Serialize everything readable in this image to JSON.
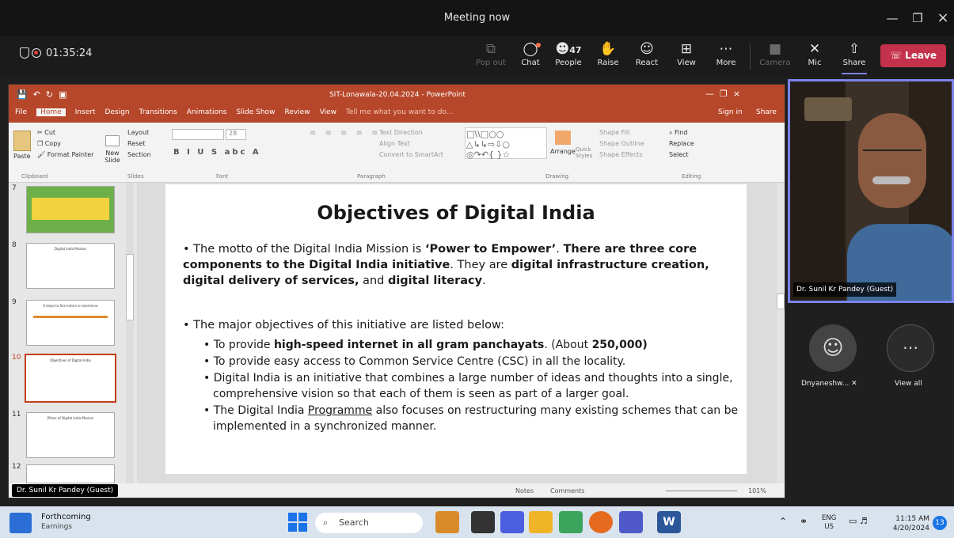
{
  "window": {
    "title": "Meeting now"
  },
  "toolbar": {
    "timer": "01:35:24",
    "buttons": [
      {
        "label": "Pop out",
        "icon": "popout-icon"
      },
      {
        "label": "Chat",
        "icon": "chat-icon"
      },
      {
        "label": "People",
        "icon": "people-icon",
        "count": "47"
      },
      {
        "label": "Raise",
        "icon": "hand-icon"
      },
      {
        "label": "React",
        "icon": "smile-icon"
      },
      {
        "label": "View",
        "icon": "grid-icon"
      },
      {
        "label": "More",
        "icon": "more-icon"
      },
      {
        "label": "Camera",
        "icon": "camera-off-icon"
      },
      {
        "label": "Mic",
        "icon": "mic-off-icon"
      },
      {
        "label": "Share",
        "icon": "share-icon"
      }
    ],
    "leave": "Leave"
  },
  "ppt": {
    "title": "SIT-Lonawala-20.04.2024 - PowerPoint",
    "tabs": [
      "File",
      "Home",
      "Insert",
      "Design",
      "Transitions",
      "Animations",
      "Slide Show",
      "Review",
      "View"
    ],
    "tellme": "Tell me what you want to do...",
    "signin": "Sign in",
    "share": "Share",
    "groups": {
      "clipboard": "Clipboard",
      "slides": "Slides",
      "font": "Font",
      "paragraph": "Paragraph",
      "drawing": "Drawing",
      "editing": "Editing"
    },
    "clip": {
      "cut": "Cut",
      "copy": "Copy",
      "painter": "Format Painter",
      "paste": "Paste"
    },
    "slidesg": {
      "layout": "Layout",
      "reset": "Reset",
      "section": "Section",
      "new": "New Slide"
    },
    "para": {
      "textdir": "Text Direction",
      "align": "Align Text",
      "smartart": "Convert to SmartArt"
    },
    "draw": {
      "fill": "Shape Fill",
      "outline": "Shape Outline",
      "effects": "Shape Effects",
      "arrange": "Arrange",
      "quick": "Quick Styles"
    },
    "edit": {
      "find": "Find",
      "replace": "Replace",
      "select": "Select"
    },
    "fontsize": "28",
    "thumbs": [
      {
        "n": "7",
        "t": ""
      },
      {
        "n": "8",
        "t": "Digital India Mission"
      },
      {
        "n": "9",
        "t": "6 steps to five India's e-commerce"
      },
      {
        "n": "10",
        "t": "Objectives of Digital India"
      },
      {
        "n": "11",
        "t": "Pillars of Digital India Mission"
      },
      {
        "n": "12",
        "t": ""
      }
    ],
    "status": {
      "notes": "Notes",
      "comments": "Comments",
      "zoom": "101%"
    }
  },
  "slide": {
    "title": "Objectives of Digital India",
    "p1": {
      "a": "The motto of the Digital India Mission is ",
      "b": "‘Power to Empower’",
      "c": ". ",
      "d": "There are three core components to the Digital India initiative",
      "e": ". They are ",
      "f": "digital infrastructure creation, digital delivery of services,",
      "g": " and ",
      "h": "digital literacy",
      "i": "."
    },
    "p2": "The major objectives of this initiative are listed below:",
    "s1": {
      "a": "To provide ",
      "b": "high-speed internet in all gram panchayats",
      "c": ". (About ",
      "d": "250,000)"
    },
    "s2": "To provide easy access to Common Service Centre (CSC) in all the locality.",
    "s3": "Digital India is an initiative that combines a large number of ideas and thoughts into a single, comprehensive vision so that each of them is seen as part of a larger goal.",
    "s4": {
      "a": "The Digital India ",
      "b": "Programme",
      "c": " also focuses on restructuring many existing schemes that can be implemented in a synchronized manner."
    }
  },
  "presenter_tag": "Dr. Sunil Kr Pandey (Guest)",
  "self_video": {
    "name": "Dr. Sunil Kr Pandey (Guest)"
  },
  "participants": [
    {
      "name": "Dnyaneshw...",
      "icon": "avatar-icon",
      "muted": true
    },
    {
      "name": "View all",
      "icon": "more-icon"
    }
  ],
  "taskbar": {
    "widget_title": "Forthcoming",
    "widget_sub": "Earnings",
    "search": "Search",
    "lang1": "ENG",
    "lang2": "US",
    "time": "11:15 AM",
    "date": "4/20/2024",
    "badge": "13"
  }
}
